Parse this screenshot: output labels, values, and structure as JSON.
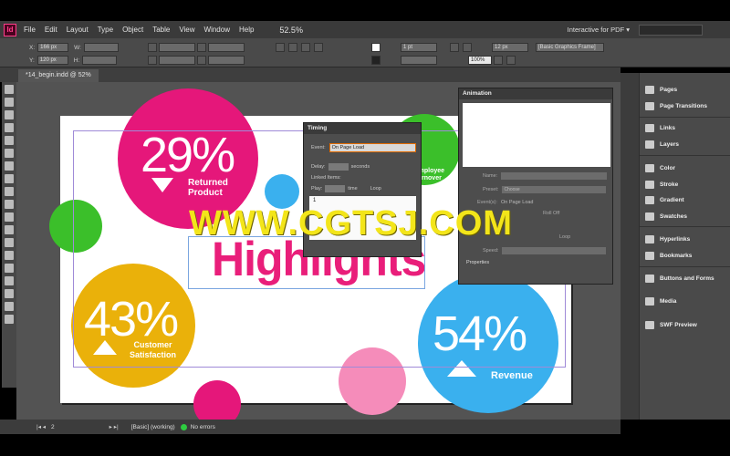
{
  "menu": {
    "items": [
      "File",
      "Edit",
      "Layout",
      "Type",
      "Object",
      "Table",
      "View",
      "Window",
      "Help"
    ],
    "zoom": "52.5%",
    "workspace": "Interactive for PDF ▾"
  },
  "control": {
    "x_label": "X:",
    "y_label": "Y:",
    "w_label": "W:",
    "h_label": "H:",
    "x_value": "166 px",
    "y_value": "120 px",
    "stroke_weight": "1 pt",
    "percent": "100%",
    "size": "12 px",
    "frame_style": "[Basic Graphics Frame]"
  },
  "document": {
    "tab_label": "*14_begin.indd @ 52%",
    "highlights": "Highlights",
    "stats": [
      {
        "value": "29%",
        "label_line1": "Returned",
        "label_line2": "Product",
        "color": "#e5177a"
      },
      {
        "value": "43%",
        "label_line1": "Customer",
        "label_line2": "Satisfaction",
        "color": "#eab10a"
      },
      {
        "value": "54%",
        "label_line1": "Revenue",
        "label_line2": "",
        "color": "#3ab0ee"
      },
      {
        "value": "%",
        "label_line1": "Employee",
        "label_line2": "Turnover",
        "color": "#3bbf2a"
      }
    ]
  },
  "timing": {
    "title": "Timing",
    "event_label": "Event:",
    "event_value": "On Page Load",
    "delay_label": "Delay:",
    "delay_unit": "seconds",
    "linked_label": "Linked Items:",
    "play_label": "Play:",
    "play_unit": "time",
    "loop_label": "Loop",
    "list_item": "1"
  },
  "animation": {
    "title": "Animation",
    "name_label": "Name:",
    "preset_label": "Preset:",
    "preset_value": "Choose",
    "events_label": "Event(s):",
    "events_value": "On Page Load",
    "rollover_value": "Roll Off",
    "speed_label": "Speed:",
    "loop_label": "Loop",
    "properties_label": "Properties"
  },
  "dock": {
    "items": [
      "Pages",
      "Page Transitions",
      "Links",
      "Layers",
      "Color",
      "Stroke",
      "Gradient",
      "Swatches",
      "Hyperlinks",
      "Bookmarks",
      "Buttons and Forms",
      "Media",
      "SWF Preview"
    ]
  },
  "status": {
    "page_number": "2",
    "master": "[Basic] (working)",
    "preflight": "No errors"
  },
  "watermark": "WWW.CGTSJ.COM"
}
